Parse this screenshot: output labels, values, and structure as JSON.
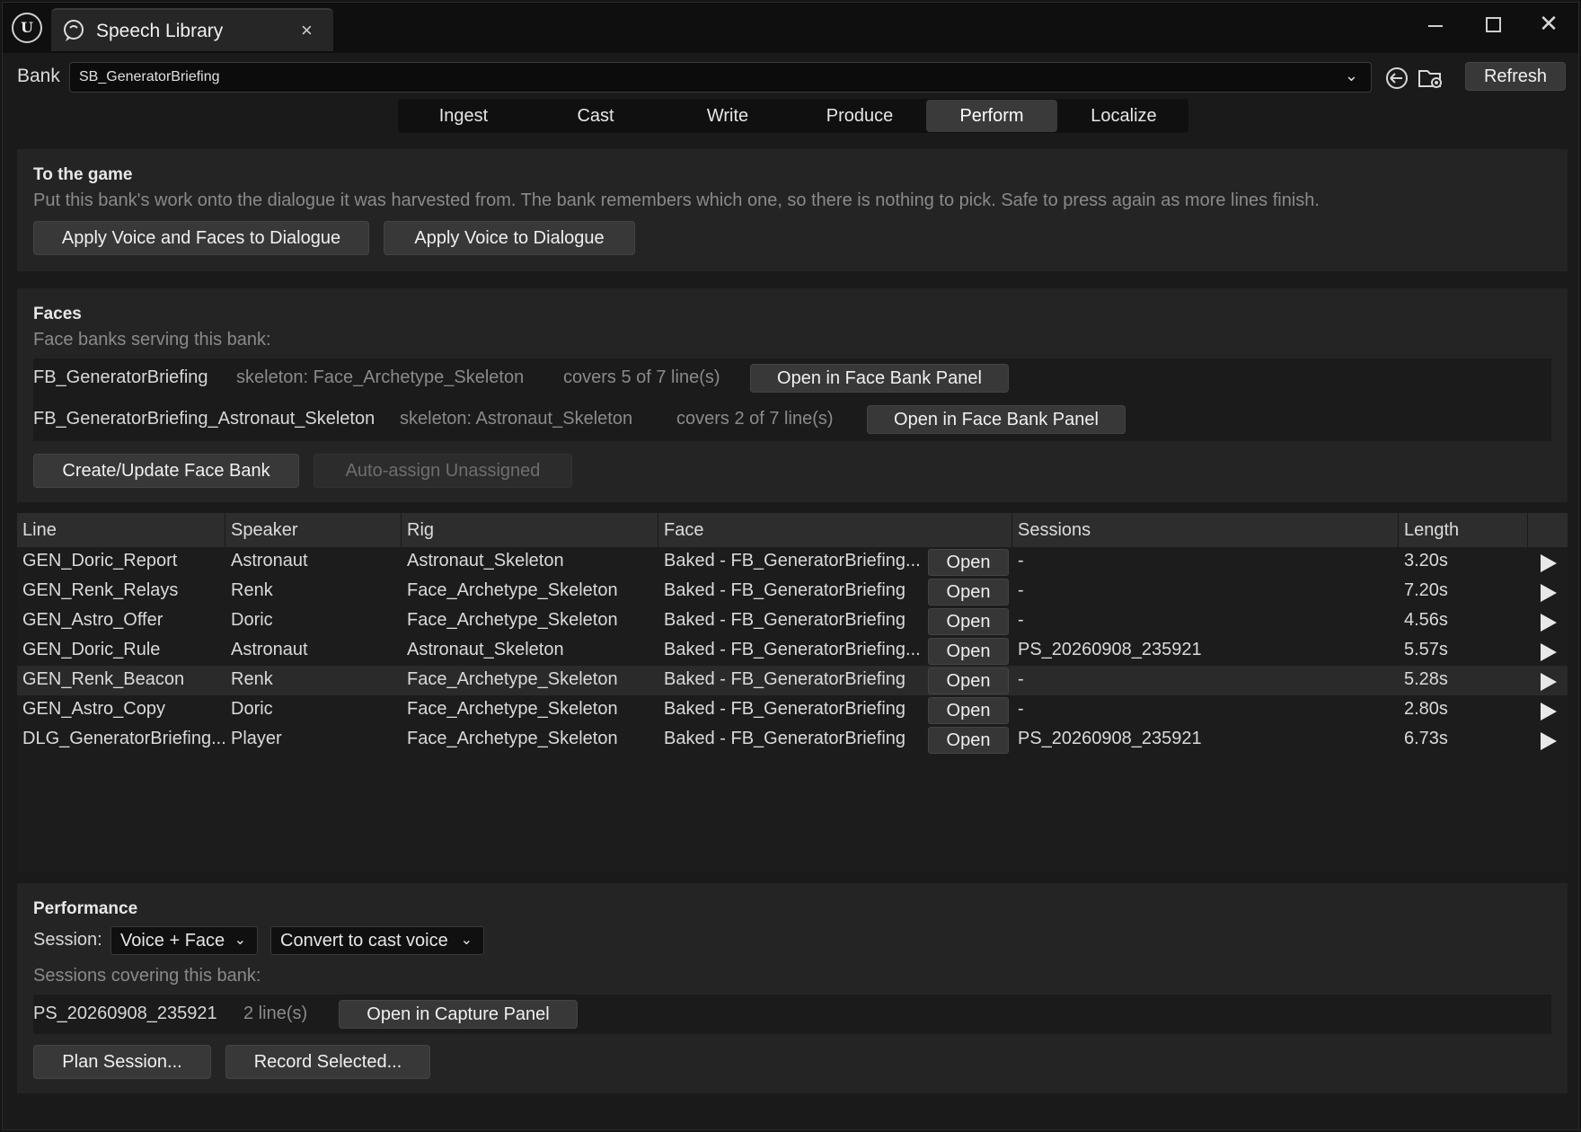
{
  "window": {
    "tab_title": "Speech Library",
    "tab_close": "×",
    "close_glyph": "✕"
  },
  "bank": {
    "label": "Bank",
    "selected": "SB_GeneratorBriefing",
    "refresh_label": "Refresh"
  },
  "modes": [
    "Ingest",
    "Cast",
    "Write",
    "Produce",
    "Perform",
    "Localize"
  ],
  "active_mode": "Perform",
  "to_game": {
    "title": "To the game",
    "description": "Put this bank's work onto the dialogue it was harvested from. The bank remembers which one, so there is nothing to pick. Safe to press again as more lines finish.",
    "apply_voice_faces": "Apply Voice and Faces to Dialogue",
    "apply_voice": "Apply Voice to Dialogue"
  },
  "faces": {
    "title": "Faces",
    "subtitle": "Face banks serving this bank:",
    "banks": [
      {
        "name": "FB_GeneratorBriefing",
        "skeleton": "skeleton: Face_Archetype_Skeleton",
        "covers": "covers 5 of 7 line(s)",
        "button": "Open in Face Bank Panel"
      },
      {
        "name": "FB_GeneratorBriefing_Astronaut_Skeleton",
        "skeleton": "skeleton: Astronaut_Skeleton",
        "covers": "covers 2 of 7 line(s)",
        "button": "Open in Face Bank Panel"
      }
    ],
    "create_update": "Create/Update Face Bank",
    "auto_assign": "Auto-assign Unassigned"
  },
  "table": {
    "headers": [
      "Line",
      "Speaker",
      "Rig",
      "Face",
      "Sessions",
      "Length"
    ],
    "open_label": "Open",
    "rows": [
      {
        "line": "GEN_Doric_Report",
        "speaker": "Astronaut",
        "rig": "Astronaut_Skeleton",
        "face": "Baked - FB_GeneratorBriefing...",
        "sessions": "-",
        "length": "3.20s"
      },
      {
        "line": "GEN_Renk_Relays",
        "speaker": "Renk",
        "rig": "Face_Archetype_Skeleton",
        "face": "Baked - FB_GeneratorBriefing",
        "sessions": "-",
        "length": "7.20s"
      },
      {
        "line": "GEN_Astro_Offer",
        "speaker": "Doric",
        "rig": "Face_Archetype_Skeleton",
        "face": "Baked - FB_GeneratorBriefing",
        "sessions": "-",
        "length": "4.56s"
      },
      {
        "line": "GEN_Doric_Rule",
        "speaker": "Astronaut",
        "rig": "Astronaut_Skeleton",
        "face": "Baked - FB_GeneratorBriefing...",
        "sessions": "PS_20260908_235921",
        "length": "5.57s"
      },
      {
        "line": "GEN_Renk_Beacon",
        "speaker": "Renk",
        "rig": "Face_Archetype_Skeleton",
        "face": "Baked - FB_GeneratorBriefing",
        "sessions": "-",
        "length": "5.28s"
      },
      {
        "line": "GEN_Astro_Copy",
        "speaker": "Doric",
        "rig": "Face_Archetype_Skeleton",
        "face": "Baked - FB_GeneratorBriefing",
        "sessions": "-",
        "length": "2.80s"
      },
      {
        "line": "DLG_GeneratorBriefing...",
        "speaker": "Player",
        "rig": "Face_Archetype_Skeleton",
        "face": "Baked - FB_GeneratorBriefing",
        "sessions": "PS_20260908_235921",
        "length": "6.73s"
      }
    ]
  },
  "performance": {
    "title": "Performance",
    "session_label": "Session:",
    "session_mode": "Voice + Face",
    "convert_mode": "Convert to cast voice",
    "sessions_subtitle": "Sessions covering this bank:",
    "sessions": [
      {
        "name": "PS_20260908_235921",
        "lines": "2 line(s)",
        "button": "Open in Capture Panel"
      }
    ],
    "plan_session": "Plan Session...",
    "record_selected": "Record Selected..."
  },
  "colors": {
    "background": "#1a1a1a",
    "panel": "#242424",
    "button": "#383838",
    "active_tab": "#3a3a3a",
    "muted_text": "#8a8a8a"
  }
}
